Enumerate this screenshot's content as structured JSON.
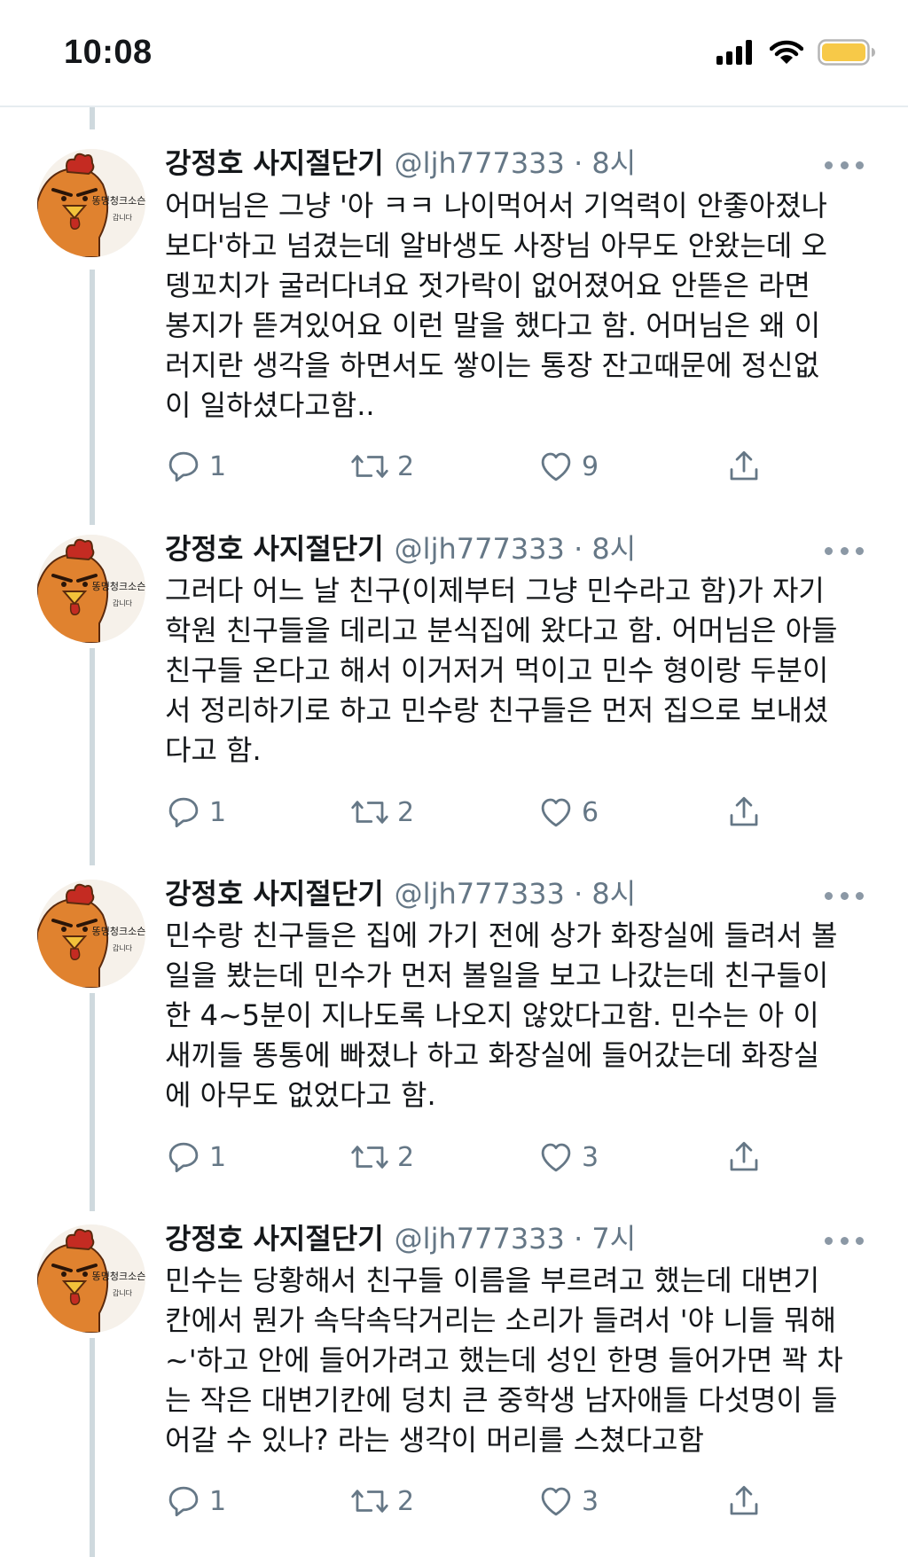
{
  "status_bar": {
    "time": "10:08"
  },
  "tweets": [
    {
      "name": "강정호 사지절단기",
      "meta": "@ljh777333 · 8시",
      "text": "어머님은 그냥 '아 ㅋㅋ 나이먹어서 기억력이 안좋아졌나\n보다'하고 넘겼는데 알바생도 사장님 아무도 안왔는데 오\n뎅꼬치가 굴러다녀요 젓가락이 없어졌어요 안뜯은 라면\n봉지가 뜯겨있어요 이런 말을 했다고 함. 어머님은 왜 이\n러지란 생각을 하면서도 쌓이는 통장 잔고때문에 정신없\n이 일하셨다고함..",
      "replies": "1",
      "retweets": "2",
      "likes": "9"
    },
    {
      "name": "강정호 사지절단기",
      "meta": "@ljh777333 · 8시",
      "text": "그러다 어느 날 친구(이제부터 그냥 민수라고 함)가 자기\n학원 친구들을 데리고 분식집에 왔다고 함. 어머님은 아들\n친구들 온다고 해서 이거저거 먹이고 민수 형이랑 두분이\n서 정리하기로 하고 민수랑 친구들은 먼저 집으로 보내셨\n다고 함.",
      "replies": "1",
      "retweets": "2",
      "likes": "6"
    },
    {
      "name": "강정호 사지절단기",
      "meta": "@ljh777333 · 8시",
      "text": "민수랑 친구들은 집에 가기 전에 상가 화장실에 들려서 볼\n일을 봤는데 민수가 먼저 볼일을 보고 나갔는데 친구들이\n한 4~5분이 지나도록 나오지 않았다고함. 민수는 아 이\n새끼들 똥통에 빠졌나 하고 화장실에 들어갔는데 화장실\n에 아무도 없었다고 함.",
      "replies": "1",
      "retweets": "2",
      "likes": "3"
    },
    {
      "name": "강정호 사지절단기",
      "meta": "@ljh777333 · 7시",
      "text": "민수는 당황해서 친구들 이름을 부르려고 했는데 대변기\n칸에서 뭔가 속닥속닥거리는 소리가 들려서 '야 니들 뭐해\n~'하고 안에 들어가려고 했는데 성인 한명 들어가면 꽉 차\n는 작은 대변기칸에 덩치 큰 중학생 남자애들 다섯명이 들\n어갈 수 있나? 라는 생각이 머리를 스쳤다고함",
      "replies": "1",
      "retweets": "2",
      "likes": "3"
    }
  ],
  "avatar_logo_text": "똥멍청크소슨",
  "avatar_sub_text": "갑니다"
}
